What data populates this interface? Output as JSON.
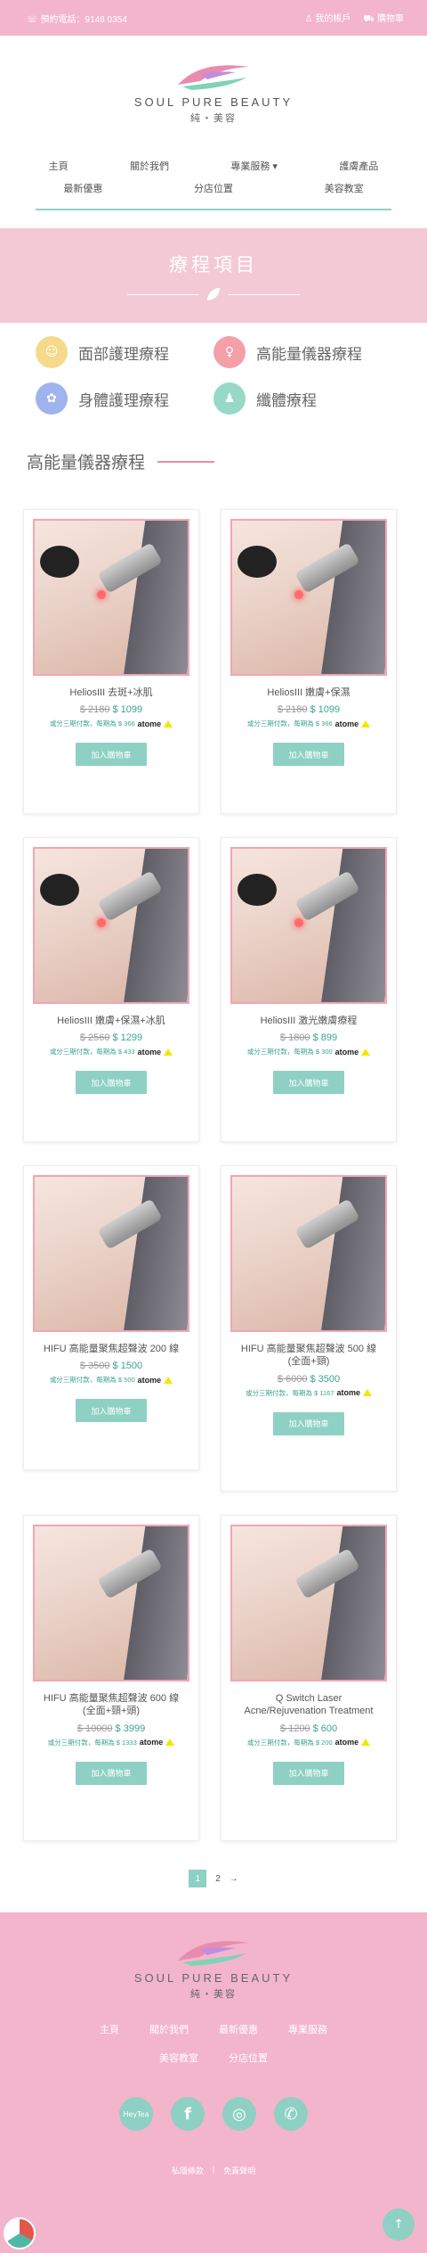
{
  "topbar": {
    "phone_label": "預約電話：9148 0354",
    "account_label": "我的帳戶",
    "cart_label": "購物車",
    "phone_icon": "phone-icon",
    "user_icon": "user-icon",
    "cart_icon": "cart-icon"
  },
  "brand": {
    "name": "SOUL PURE BEAUTY",
    "sub": "純・美容"
  },
  "nav": {
    "row1": [
      "主頁",
      "關於我們",
      "專業服務",
      "護膚產品"
    ],
    "row2": [
      "最新優惠",
      "分店位置",
      "美容教室"
    ]
  },
  "hero": {
    "title": "療程項目"
  },
  "categories": [
    {
      "label": "面部護理療程",
      "color": "#f5da8c"
    },
    {
      "label": "高能量儀器療程",
      "color": "#f3a0a8"
    },
    {
      "label": "身體護理療程",
      "color": "#9fb3ee"
    },
    {
      "label": "纖體療程",
      "color": "#96d9c6"
    }
  ],
  "section": {
    "title": "高能量儀器療程"
  },
  "products": [
    {
      "name": "HeliosIII 去斑+冰肌",
      "old": "$ 2180",
      "new": "$ 1099",
      "atome": "或分三期付款，每期為 $ 366",
      "btn": "加入購物車"
    },
    {
      "name": "HeliosIII 嫩膚+保濕",
      "old": "$ 2180",
      "new": "$ 1099",
      "atome": "或分三期付款，每期為 $ 366",
      "btn": "加入購物車"
    },
    {
      "name": "HeliosIII 嫩膚+保濕+冰肌",
      "old": "$ 2560",
      "new": "$ 1299",
      "atome": "或分三期付款，每期為 $ 433",
      "btn": "加入購物車"
    },
    {
      "name": "HeliosIII 激光嫩膚療程",
      "old": "$ 1800",
      "new": "$ 899",
      "atome": "或分三期付款，每期為 $ 300",
      "btn": "加入購物車"
    },
    {
      "name": "HIFU 高能量聚焦超聲波 200 線",
      "old": "$ 3500",
      "new": "$ 1500",
      "atome": "或分三期付款，每期為 $ 500",
      "btn": "加入購物車"
    },
    {
      "name": "HIFU 高能量聚焦超聲波 500 線 (全面+頸)",
      "old": "$ 6000",
      "new": "$ 3500",
      "atome": "或分三期付款，每期為 $ 1167",
      "btn": "加入購物車"
    },
    {
      "name": "HIFU 高能量聚焦超聲波 600 線 (全面+頸+頭)",
      "old": "$ 10000",
      "new": "$ 3999",
      "atome": "或分三期付款，每期為 $ 1333",
      "btn": "加入購物車"
    },
    {
      "name": "Q Switch Laser Acne/Rejuvenation Treatment",
      "old": "$ 1200",
      "new": "$ 600",
      "atome": "或分三期付款，每期為 $ 200",
      "btn": "加入購物車"
    }
  ],
  "atome_brand": "atome",
  "pager": {
    "current": "1",
    "next": "2",
    "arrow": "→"
  },
  "footer": {
    "links": [
      "主頁",
      "關於我們",
      "最新優惠",
      "專業服務",
      "美容教室",
      "分店位置"
    ],
    "socials": [
      "HeyTea",
      "f",
      "◎",
      "✆"
    ],
    "legal": [
      "私隱條款",
      "免責聲明"
    ],
    "to_top": "↑"
  }
}
